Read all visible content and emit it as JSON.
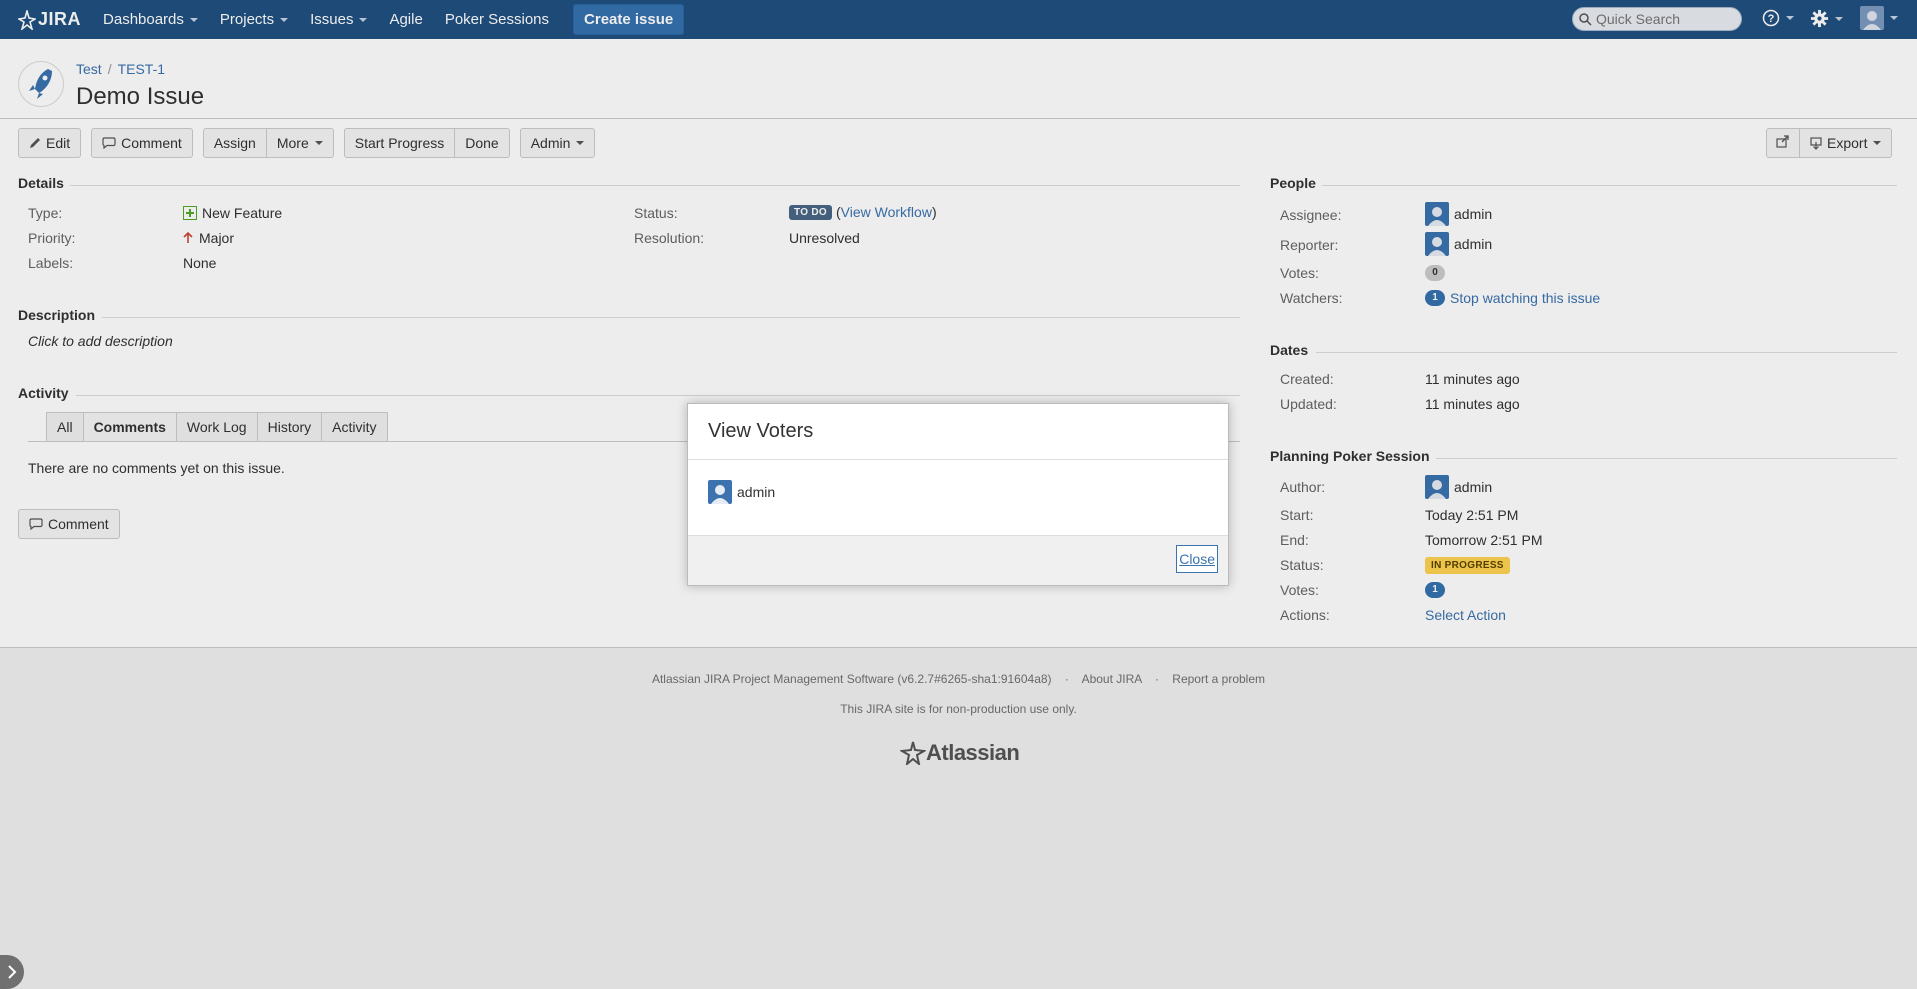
{
  "header": {
    "logo_text": "JIRA",
    "nav": [
      "Dashboards",
      "Projects",
      "Issues",
      "Agile",
      "Poker Sessions"
    ],
    "create_label": "Create issue",
    "search_placeholder": "Quick Search"
  },
  "issue": {
    "project": "Test",
    "key": "TEST-1",
    "title": "Demo Issue"
  },
  "toolbar": {
    "edit": "Edit",
    "comment": "Comment",
    "assign": "Assign",
    "more": "More",
    "start_progress": "Start Progress",
    "done": "Done",
    "admin": "Admin",
    "export": "Export"
  },
  "details": {
    "heading": "Details",
    "type_label": "Type:",
    "type_value": "New Feature",
    "priority_label": "Priority:",
    "priority_value": "Major",
    "labels_label": "Labels:",
    "labels_value": "None",
    "status_label": "Status:",
    "status_value": "TO DO",
    "view_workflow": "View Workflow",
    "resolution_label": "Resolution:",
    "resolution_value": "Unresolved"
  },
  "description": {
    "heading": "Description",
    "placeholder": "Click to add description"
  },
  "activity": {
    "heading": "Activity",
    "tabs": [
      "All",
      "Comments",
      "Work Log",
      "History",
      "Activity"
    ],
    "active_tab": "Comments",
    "empty_text": "There are no comments yet on this issue.",
    "comment_button": "Comment"
  },
  "people": {
    "heading": "People",
    "assignee_label": "Assignee:",
    "assignee": "admin",
    "reporter_label": "Reporter:",
    "reporter": "admin",
    "votes_label": "Votes:",
    "votes": "0",
    "watchers_label": "Watchers:",
    "watchers": "1",
    "watch_link": "Stop watching this issue"
  },
  "dates": {
    "heading": "Dates",
    "created_label": "Created:",
    "created": "11 minutes ago",
    "updated_label": "Updated:",
    "updated": "11 minutes ago"
  },
  "poker": {
    "heading": "Planning Poker Session",
    "author_label": "Author:",
    "author": "admin",
    "start_label": "Start:",
    "start": "Today 2:51 PM",
    "end_label": "End:",
    "end": "Tomorrow 2:51 PM",
    "status_label": "Status:",
    "status": "IN PROGRESS",
    "votes_label": "Votes:",
    "votes": "1",
    "actions_label": "Actions:",
    "actions_link": "Select Action"
  },
  "footer": {
    "software": "Atlassian JIRA Project Management Software (v6.2.7#6265-sha1:91604a8)",
    "about": "About JIRA",
    "report": "Report a problem",
    "notice": "This JIRA site is for non-production use only.",
    "brand": "Atlassian"
  },
  "dialog": {
    "title": "View Voters",
    "voter": "admin",
    "close": "Close"
  },
  "colors": {
    "header_bg": "#205081",
    "link": "#3b73af",
    "todo_lozenge": "#4a6785",
    "inprogress_lozenge": "#ffd351"
  }
}
